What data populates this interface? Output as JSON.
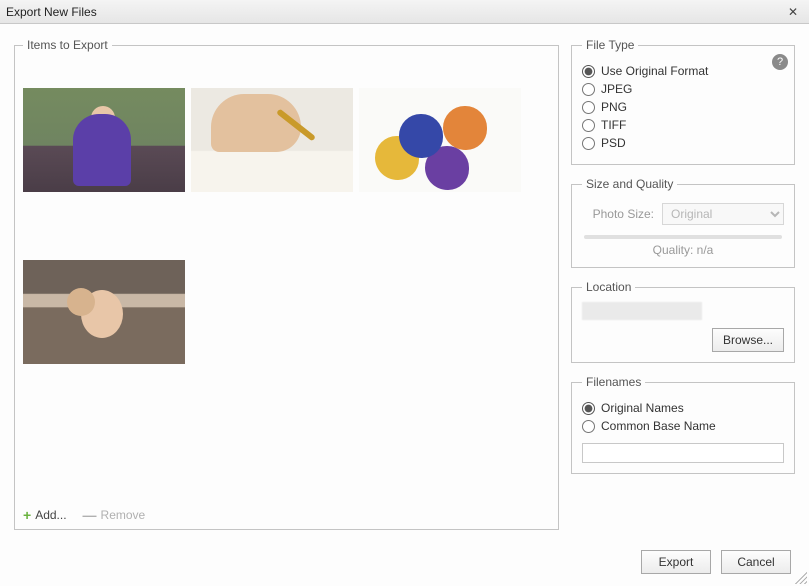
{
  "window": {
    "title": "Export New Files"
  },
  "items": {
    "legend": "Items to Export",
    "add_label": "Add...",
    "remove_label": "Remove"
  },
  "fileType": {
    "legend": "File Type",
    "selected": "original",
    "options": {
      "original": "Use Original Format",
      "jpeg": "JPEG",
      "png": "PNG",
      "tiff": "TIFF",
      "psd": "PSD"
    }
  },
  "sizeQuality": {
    "legend": "Size and Quality",
    "photo_size_label": "Photo Size:",
    "photo_size_value": "Original",
    "quality_label": "Quality: n/a"
  },
  "location": {
    "legend": "Location",
    "browse_label": "Browse..."
  },
  "filenames": {
    "legend": "Filenames",
    "selected": "original",
    "original_label": "Original Names",
    "common_label": "Common Base Name",
    "base_name_value": ""
  },
  "footer": {
    "export_label": "Export",
    "cancel_label": "Cancel"
  }
}
